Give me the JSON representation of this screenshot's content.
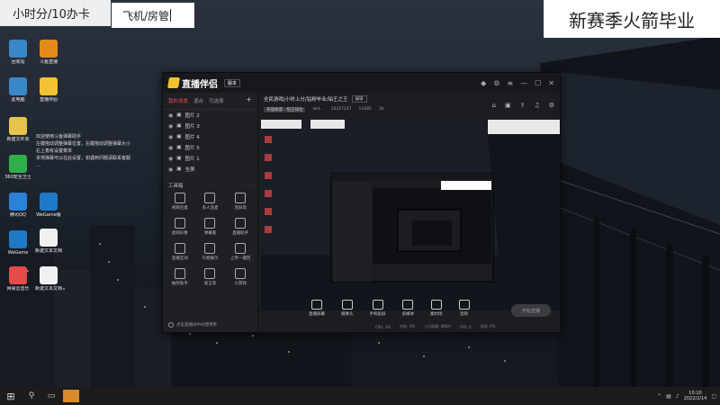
{
  "overlays": {
    "title_left": "小时分/10办卡",
    "search_text": "飞机/房管",
    "title_right": "新赛季火箭毕业"
  },
  "desktop": {
    "icons": [
      {
        "label": "回收站",
        "icon": "recycle-bin-icon"
      },
      {
        "label": "此电脑",
        "icon": "computer-icon"
      },
      {
        "label": "新建文件夹",
        "icon": "folder-icon"
      },
      {
        "label": "360安全卫士",
        "icon": "360-icon"
      },
      {
        "label": "腾讯QQ",
        "icon": "qq-icon"
      },
      {
        "label": "WeGame",
        "icon": "wegame-icon"
      },
      {
        "label": "斗鱼直播",
        "icon": "douyu-icon"
      },
      {
        "label": "直播伴侣",
        "icon": "live-companion-icon"
      },
      {
        "label": "网易云音乐",
        "icon": "music-icon"
      },
      {
        "label": "新建文本文档",
        "icon": "text-file-icon"
      },
      {
        "label": "新建文本文档",
        "icon": "text-file-icon"
      },
      {
        "label": "WeGame版",
        "icon": "wegame-icon"
      }
    ],
    "helper_lines": [
      "欢迎使用斗鱼弹幕助手",
      "左键拖动调整弹幕位置，右键拖动调整弹幕大小",
      "右上角有设置菜单",
      "本地弹幕可以在此设置，如遇到问题请联系客服",
      "..."
    ]
  },
  "app": {
    "name": "直播伴侣",
    "version": "版本",
    "tabs": [
      "我的场景",
      "混合",
      "可选择"
    ],
    "scenes": [
      "图片 2",
      "图片 3",
      "图片 4",
      "图片 5",
      "图片 1",
      "全屏"
    ],
    "toolbox_title": "工具箱",
    "tools": [
      "视频连麦",
      "多人连麦",
      "连屏等",
      "虚拟形象",
      "弹幕看",
      "直播助手",
      "直播互动",
      "礼物展示",
      "上传一键回",
      "抽奖助手",
      "发言等",
      "小游戏"
    ],
    "left_footer": "点击直播间中间使用率",
    "room_title": "全民游戏|小时上分/钻粉毕业/铂王之王",
    "edit_label": "编辑",
    "room_meta": [
      "英雄联盟 - 铂王排位",
      "wid...",
      "10327247",
      "11685",
      "34"
    ],
    "bottom_tools": [
      "直播屏幕",
      "摄像头",
      "手机投屏",
      "多媒体",
      "素材场",
      "话筒"
    ],
    "start_button": "开始直播",
    "status": [
      "CPU: 3%",
      "内存: 3%",
      "上行网速: 0KB/s",
      "FPS: 0",
      "丢帧: 0%"
    ]
  },
  "taskbar": {
    "time": "10:10",
    "date": "2022/2/14"
  }
}
